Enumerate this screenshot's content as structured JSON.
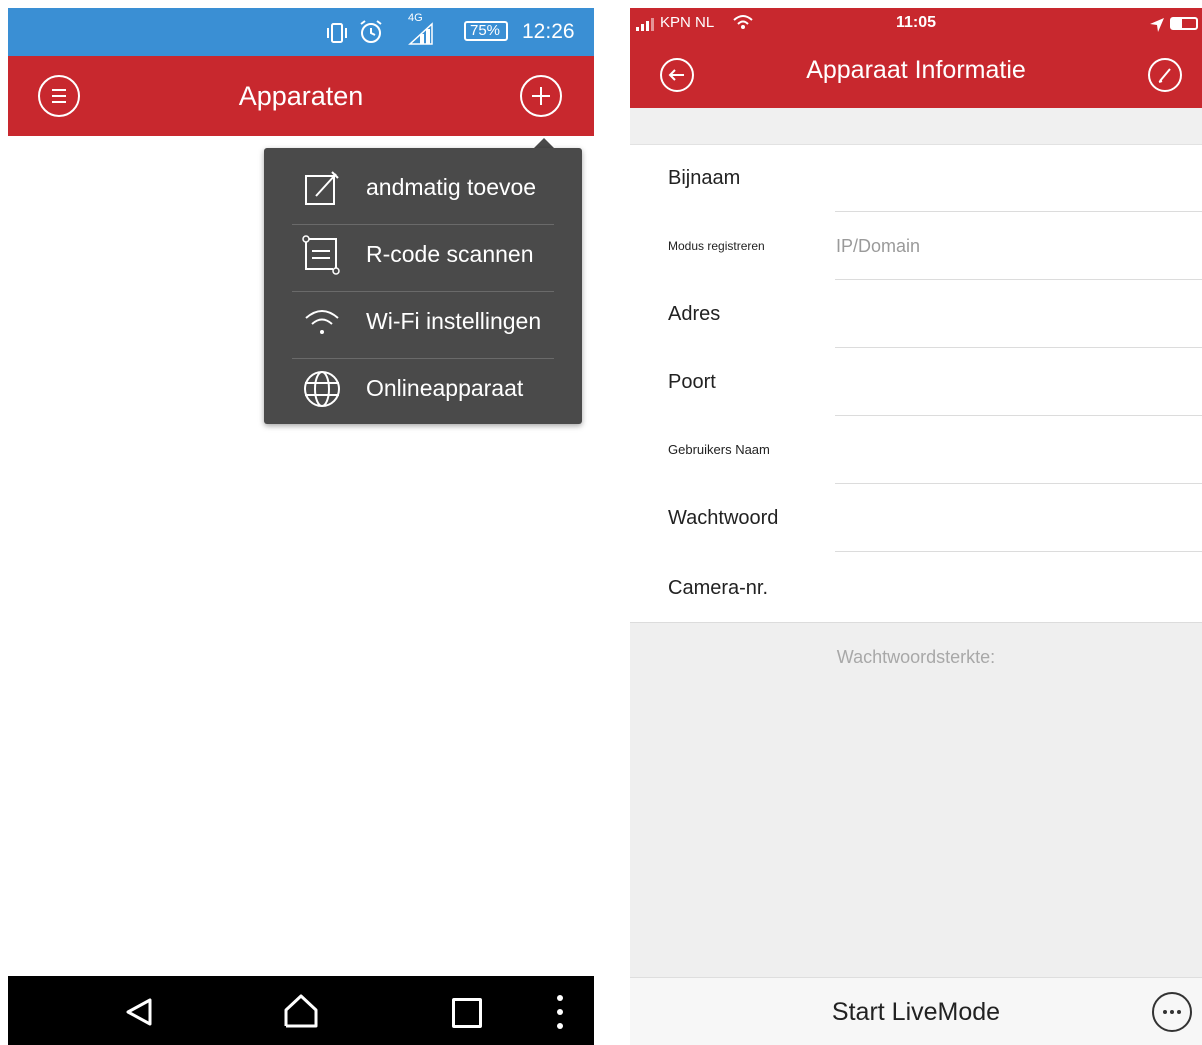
{
  "left_screen": {
    "status_bar": {
      "network": "4G",
      "battery": "75%",
      "time": "12:26"
    },
    "app_bar": {
      "title": "Apparaten",
      "menu_icon": "hamburger-circle-icon",
      "add_icon": "plus-circle-icon"
    },
    "popup_menu": {
      "items": [
        {
          "label": "andmatig toevoe",
          "icon": "edit-icon"
        },
        {
          "label": "R-code scannen",
          "icon": "qr-scan-icon"
        },
        {
          "label": "Wi-Fi instellingen",
          "icon": "wifi-icon"
        },
        {
          "label": "Onlineapparaat",
          "icon": "globe-icon"
        }
      ]
    },
    "nav_bar": {
      "icons": [
        "back-icon",
        "home-icon",
        "recents-icon",
        "overflow-icon"
      ]
    }
  },
  "right_screen": {
    "status_bar": {
      "carrier": "KPN NL",
      "time": "11:05"
    },
    "header": {
      "title": "Apparaat Informatie",
      "back_icon": "back-arrow-circle-icon",
      "edit_icon": "pencil-circle-icon"
    },
    "form": {
      "fields": [
        {
          "label": "Bijnaam",
          "value": ""
        },
        {
          "label": "Modus registreren",
          "value": "IP/Domain"
        },
        {
          "label": "Adres",
          "value": ""
        },
        {
          "label": "Poort",
          "value": ""
        },
        {
          "label": "Gebruikers Naam",
          "value": ""
        },
        {
          "label": "Wachtwoord",
          "value": ""
        },
        {
          "label": "Camera-nr.",
          "value": ""
        }
      ]
    },
    "password_strength_label": "Wachtwoordsterkte:",
    "bottom_bar": {
      "button_label": "Start LiveMode",
      "more_icon": "more-circle-icon"
    }
  },
  "colors": {
    "android_status": "#3a8fd4",
    "brand_red": "#c8282e",
    "menu_bg": "#4a4a4a"
  }
}
